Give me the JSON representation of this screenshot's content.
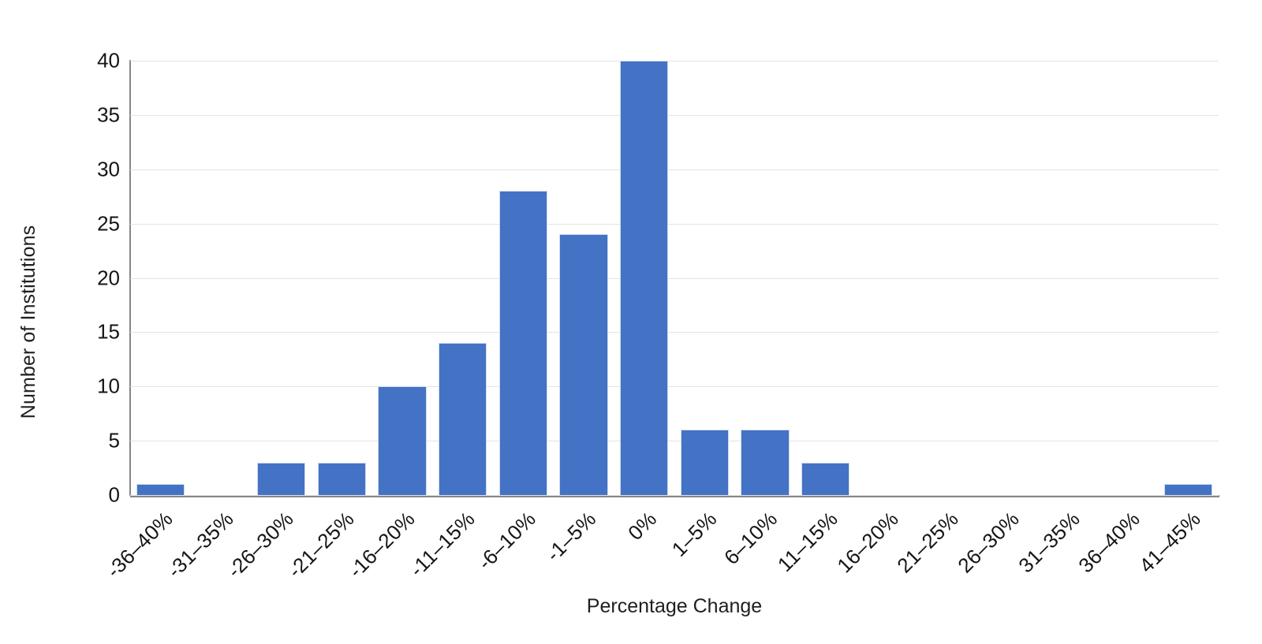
{
  "chart_data": {
    "type": "bar",
    "title": "",
    "xlabel": "Percentage Change",
    "ylabel": "Number of Institutions",
    "categories": [
      "-36–40%",
      "-31–35%",
      "-26–30%",
      "-21–25%",
      "-16–20%",
      "-11–15%",
      "-6–10%",
      "-1–5%",
      "0%",
      "1–5%",
      "6–10%",
      "11–15%",
      "16–20%",
      "21–25%",
      "26–30%",
      "31–35%",
      "36–40%",
      "41–45%"
    ],
    "values": [
      1,
      0,
      3,
      3,
      10,
      14,
      28,
      24,
      40,
      6,
      6,
      3,
      0,
      0,
      0,
      0,
      0,
      1
    ],
    "ylim": [
      0,
      40
    ],
    "y_ticks": [
      0,
      5,
      10,
      15,
      20,
      25,
      30,
      35,
      40
    ],
    "y_tick_labels": [
      "0",
      "5",
      "10",
      "15",
      "20",
      "25",
      "30",
      "35",
      "40"
    ],
    "grid": true,
    "legend": false,
    "bar_color": "#4472C4",
    "gridline_color": "#E3E3E3",
    "axis_color": "#868686"
  }
}
